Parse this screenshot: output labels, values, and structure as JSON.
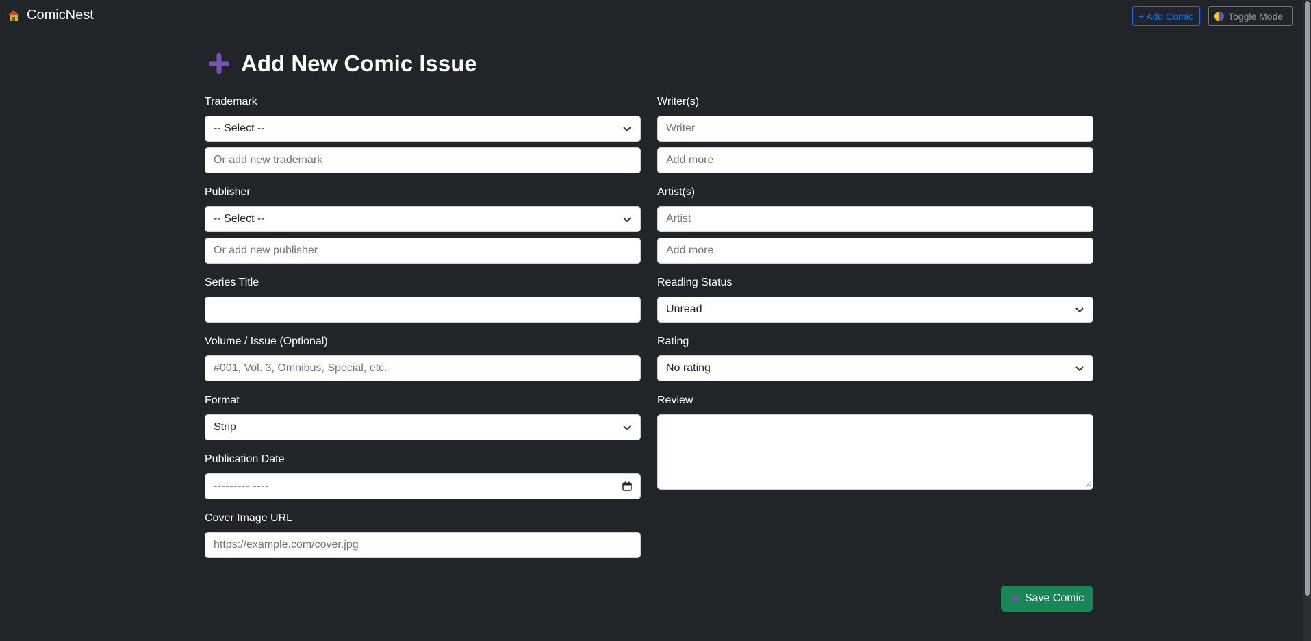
{
  "navbar": {
    "brand": "ComicNest",
    "brand_icon": "house-icon",
    "add_comic": "+ Add Comic",
    "toggle_mode": "Toggle Mode"
  },
  "page": {
    "title": "Add New Comic Issue",
    "title_icon": "plus-icon"
  },
  "form": {
    "trademark": {
      "label": "Trademark",
      "select_value": "-- Select --",
      "new_placeholder": "Or add new trademark"
    },
    "publisher": {
      "label": "Publisher",
      "select_value": "-- Select --",
      "new_placeholder": "Or add new publisher"
    },
    "series_title": {
      "label": "Series Title",
      "value": ""
    },
    "volume_issue": {
      "label": "Volume / Issue (Optional)",
      "placeholder": "#001, Vol. 3, Omnibus, Special, etc."
    },
    "format": {
      "label": "Format",
      "select_value": "Strip"
    },
    "publication_date": {
      "label": "Publication Date",
      "value": "--------- ----"
    },
    "cover_image_url": {
      "label": "Cover Image URL",
      "placeholder": "https://example.com/cover.jpg"
    },
    "writers": {
      "label": "Writer(s)",
      "placeholder": "Writer",
      "more_placeholder": "Add more"
    },
    "artists": {
      "label": "Artist(s)",
      "placeholder": "Artist",
      "more_placeholder": "Add more"
    },
    "reading_status": {
      "label": "Reading Status",
      "select_value": "Unread"
    },
    "rating": {
      "label": "Rating",
      "select_value": "No rating"
    },
    "review": {
      "label": "Review",
      "value": ""
    }
  },
  "actions": {
    "save": "Save Comic"
  },
  "colors": {
    "background": "#212529",
    "primary": "#0d6efd",
    "success": "#198754",
    "accent_purple": "#7952b3"
  }
}
